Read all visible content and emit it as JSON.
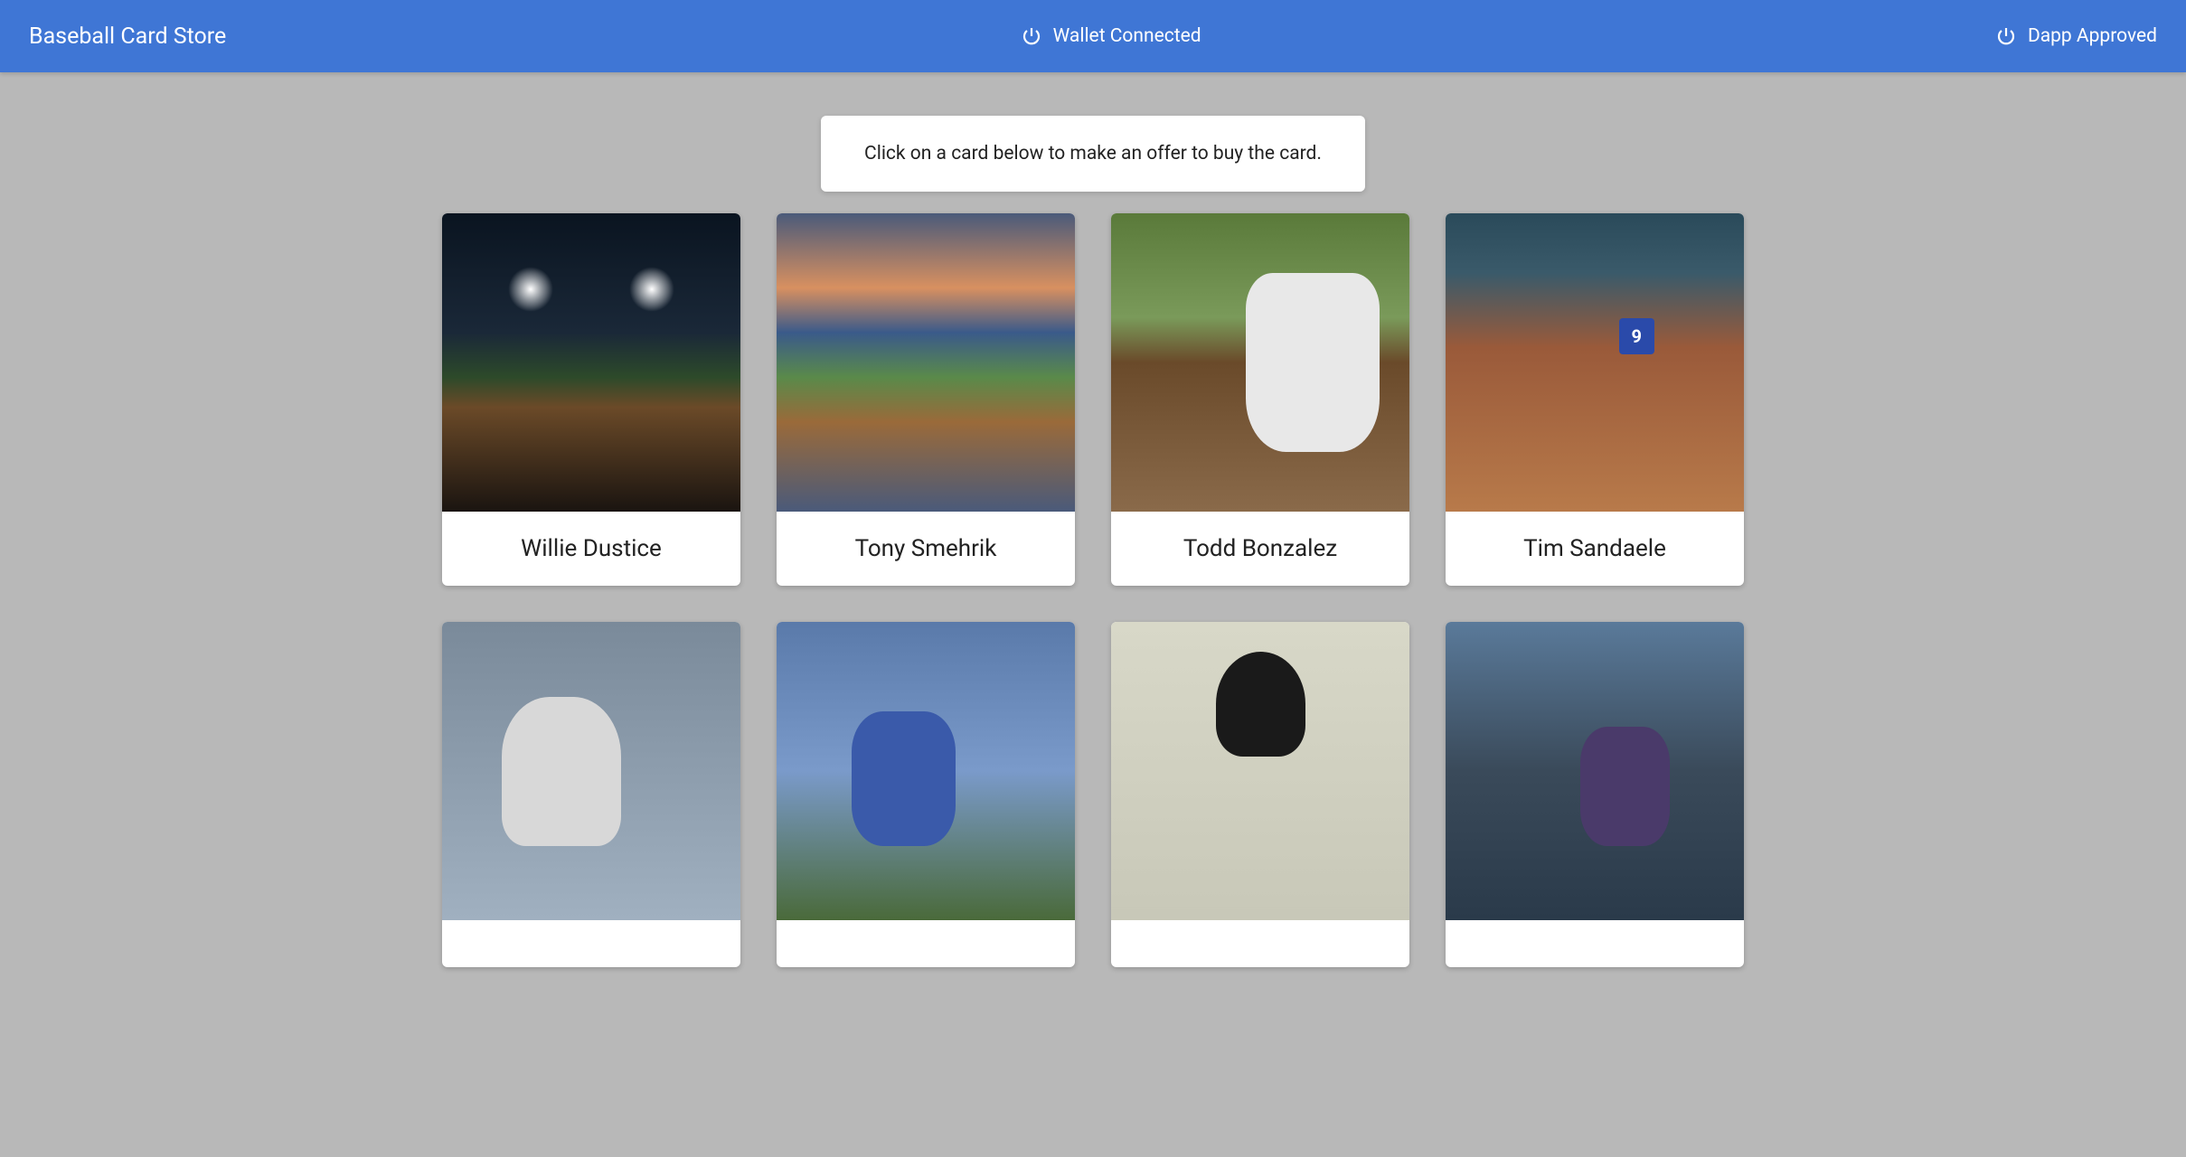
{
  "header": {
    "title": "Baseball Card Store",
    "wallet_status": "Wallet Connected",
    "dapp_status": "Dapp Approved"
  },
  "instruction": "Click on a card below to make an offer to buy the card.",
  "cards": [
    {
      "name": "Willie Dustice"
    },
    {
      "name": "Tony Smehrik"
    },
    {
      "name": "Todd Bonzalez"
    },
    {
      "name": "Tim Sandaele"
    },
    {
      "name": ""
    },
    {
      "name": ""
    },
    {
      "name": ""
    },
    {
      "name": ""
    }
  ]
}
